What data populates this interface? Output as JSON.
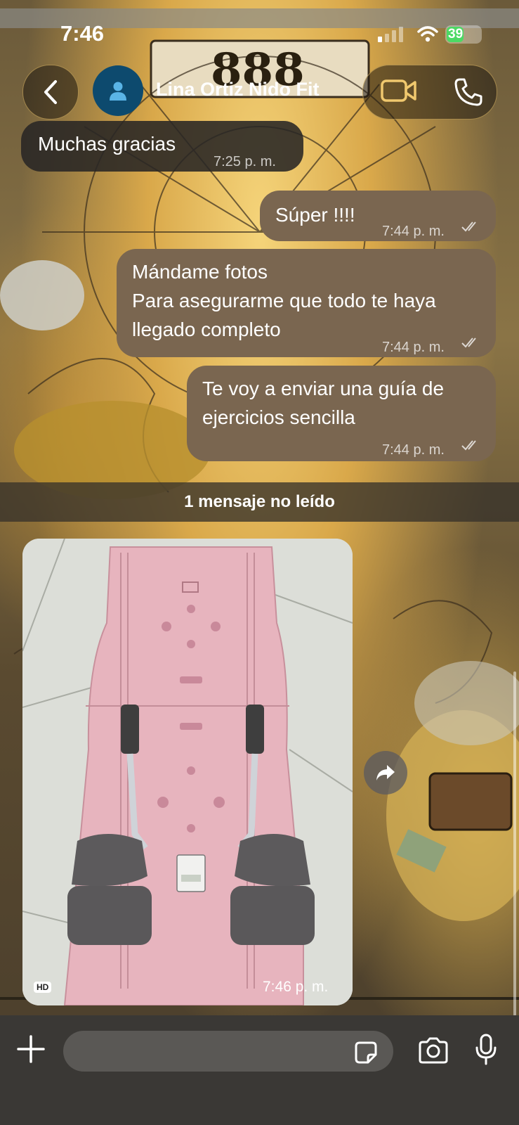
{
  "status": {
    "time": "7:46",
    "battery": "39"
  },
  "header": {
    "contact_name": "Lina Ortiz Nido Fit"
  },
  "messages": [
    {
      "dir": "in",
      "text": "Muchas gracias",
      "time": "7:25 p. m."
    },
    {
      "dir": "out",
      "text": "Súper !!!!",
      "time": "7:44 p. m."
    },
    {
      "dir": "out",
      "text": "Mándame fotos\nPara asegurarme que todo te haya\nllegado completo",
      "time": "7:44 p. m."
    },
    {
      "dir": "out",
      "text": "Te voy a enviar una guía de\nejercicios sencilla",
      "time": "7:44 p. m."
    }
  ],
  "unread_label": "1 mensaje no leído",
  "photo_message": {
    "hd_badge": "HD",
    "time": "7:46 p. m."
  },
  "wallpaper_text": "888",
  "colors": {
    "incoming_bubble": "#282624",
    "outgoing_bubble": "#7a6650",
    "accent": "#f0c86e",
    "avatar": "#0d4a6e"
  }
}
